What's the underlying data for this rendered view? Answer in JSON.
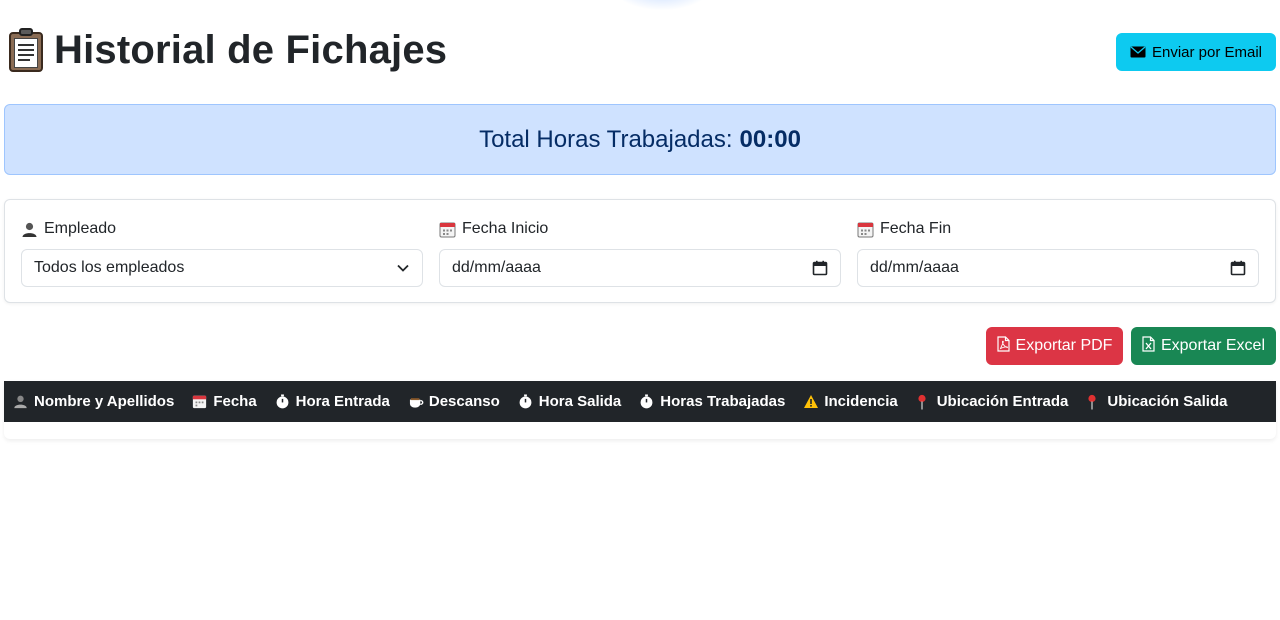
{
  "header": {
    "title": "Historial de Fichajes",
    "title_icon": "clipboard-icon",
    "email_button": {
      "label": "Enviar por Email",
      "icon": "envelope-icon",
      "color": "#0dcaf0"
    }
  },
  "summary": {
    "label": "Total Horas Trabajadas:",
    "value": "00:00",
    "background": "#cfe2ff"
  },
  "filters": {
    "employee": {
      "label": "Empleado",
      "icon": "user-icon",
      "selected": "Todos los empleados"
    },
    "start_date": {
      "label": "Fecha Inicio",
      "icon": "calendar-icon",
      "placeholder": "dd/mm/aaaa"
    },
    "end_date": {
      "label": "Fecha Fin",
      "icon": "calendar-icon",
      "placeholder": "dd/mm/aaaa"
    }
  },
  "actions": {
    "export_pdf": {
      "label": "Exportar PDF",
      "icon": "file-pdf-icon",
      "color": "#dc3545"
    },
    "export_excel": {
      "label": "Exportar Excel",
      "icon": "file-excel-icon",
      "color": "#198754"
    }
  },
  "table": {
    "columns": [
      {
        "label": "Nombre y Apellidos",
        "icon": "user-icon"
      },
      {
        "label": "Fecha",
        "icon": "calendar-icon"
      },
      {
        "label": "Hora Entrada",
        "icon": "stopwatch-icon"
      },
      {
        "label": "Descanso",
        "icon": "coffee-icon"
      },
      {
        "label": "Hora Salida",
        "icon": "stopwatch-icon"
      },
      {
        "label": "Horas Trabajadas",
        "icon": "stopwatch-icon"
      },
      {
        "label": "Incidencia",
        "icon": "warning-icon"
      },
      {
        "label": "Ubicación Entrada",
        "icon": "pin-icon"
      },
      {
        "label": "Ubicación Salida",
        "icon": "pin-icon"
      }
    ],
    "rows": []
  }
}
